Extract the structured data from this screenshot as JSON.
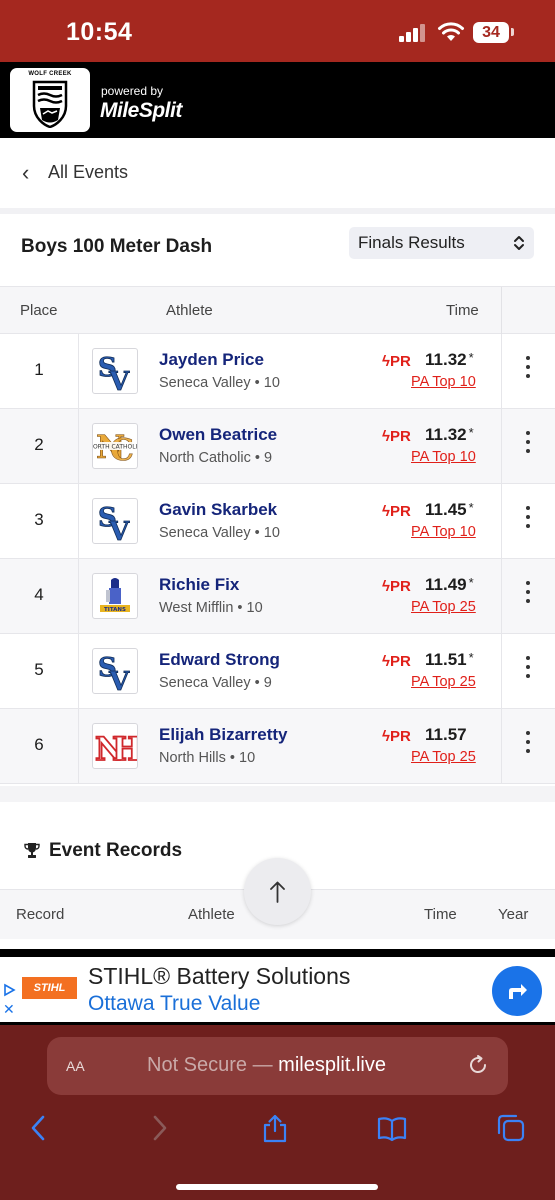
{
  "status": {
    "time": "10:54",
    "battery": "34"
  },
  "brand": {
    "school": "WOLF CREEK",
    "powered_by": "powered by",
    "product": "MileSplit"
  },
  "nav": {
    "back_label": "All Events"
  },
  "event": {
    "title": "Boys 100 Meter Dash",
    "select_value": "Finals Results"
  },
  "table": {
    "headers": {
      "place": "Place",
      "athlete": "Athlete",
      "time": "Time"
    },
    "rows": [
      {
        "place": "1",
        "name": "Jayden Price",
        "team": "Seneca Valley • 10",
        "pr": "PR",
        "time": "11.32",
        "mark": "*",
        "rank": "PA Top 10",
        "logo": "sv"
      },
      {
        "place": "2",
        "name": "Owen Beatrice",
        "team": "North Catholic • 9",
        "pr": "PR",
        "time": "11.32",
        "mark": "*",
        "rank": "PA Top 10",
        "logo": "nc"
      },
      {
        "place": "3",
        "name": "Gavin Skarbek",
        "team": "Seneca Valley • 10",
        "pr": "PR",
        "time": "11.45",
        "mark": "*",
        "rank": "PA Top 10",
        "logo": "sv"
      },
      {
        "place": "4",
        "name": "Richie Fix",
        "team": "West Mifflin • 10",
        "pr": "PR",
        "time": "11.49",
        "mark": "*",
        "rank": "PA Top 25",
        "logo": "wm"
      },
      {
        "place": "5",
        "name": "Edward Strong",
        "team": "Seneca Valley • 9",
        "pr": "PR",
        "time": "11.51",
        "mark": "*",
        "rank": "PA Top 25",
        "logo": "sv"
      },
      {
        "place": "6",
        "name": "Elijah Bizarretty",
        "team": "North Hills • 10",
        "pr": "PR",
        "time": "11.57",
        "mark": "",
        "rank": "PA Top 25",
        "logo": "nh"
      }
    ]
  },
  "records": {
    "title": "Event Records",
    "headers": {
      "record": "Record",
      "athlete": "Athlete",
      "time": "Time",
      "year": "Year"
    }
  },
  "ad": {
    "brand": "STIHL",
    "headline": "STIHL® Battery Solutions",
    "sub": "Ottawa True Value"
  },
  "browser": {
    "aa": "AA",
    "not_secure": "Not Secure — ",
    "host": "milesplit.live"
  },
  "colors": {
    "status_bar": "#a5281f",
    "browser_bar": "#6e1f1d",
    "accent_red": "#e0201a",
    "name_blue": "#15257a"
  }
}
